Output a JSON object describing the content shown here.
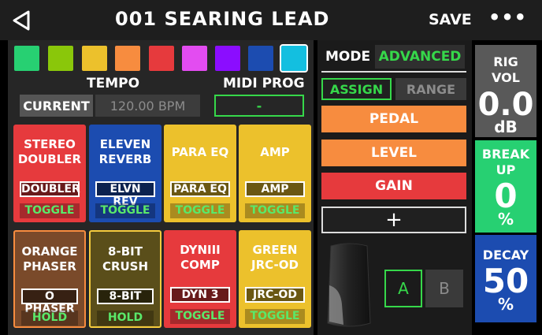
{
  "header": {
    "title": "001 SEARING LEAD",
    "save_label": "SAVE",
    "more_label": "•••"
  },
  "colors": [
    "#27d072",
    "#8ac70a",
    "#ecc12c",
    "#f78c3f",
    "#e63a3d",
    "#e34cf1",
    "#8b0dff",
    "#1c4cb0",
    "#13bfe0"
  ],
  "tempo": {
    "label": "TEMPO",
    "mode": "CURRENT",
    "value": "120.00 BPM"
  },
  "midi": {
    "label": "MIDI PROG",
    "value": "-"
  },
  "footswitches": [
    {
      "name1": "STEREO",
      "name2": "DOUBLER",
      "label": "DOUBLER",
      "action": "TOGGLE",
      "color": "#e63a3d"
    },
    {
      "name1": "ELEVEN",
      "name2": "REVERB",
      "label": "ELVN REV",
      "action": "TOGGLE",
      "color": "#1c4cb0"
    },
    {
      "name1": "PARA EQ",
      "name2": "",
      "label": "PARA EQ",
      "action": "TOGGLE",
      "color": "#ecc12c"
    },
    {
      "name1": "AMP",
      "name2": "",
      "label": "AMP",
      "action": "TOGGLE",
      "color": "#ecc12c"
    },
    {
      "name1": "ORANGE",
      "name2": "PHASER",
      "label": "O PHASER",
      "action": "HOLD",
      "color": "#7a4a2a"
    },
    {
      "name1": "8-BIT",
      "name2": "CRUSH",
      "label": "8-BIT",
      "action": "HOLD",
      "color": "#5a4e1a"
    },
    {
      "name1": "DYNIII",
      "name2": "COMP",
      "label": "DYN 3",
      "action": "TOGGLE",
      "color": "#e63a3d"
    },
    {
      "name1": "GREEN",
      "name2": "JRC-OD",
      "label": "JRC-OD",
      "action": "TOGGLE",
      "color": "#ecc12c"
    }
  ],
  "mode": {
    "label": "MODE",
    "value": "ADVANCED"
  },
  "tabs": {
    "assign": "ASSIGN",
    "range": "RANGE"
  },
  "assignments": [
    {
      "label": "PEDAL",
      "color": "#f78c3f"
    },
    {
      "label": "LEVEL",
      "color": "#f78c3f"
    },
    {
      "label": "GAIN",
      "color": "#e63a3d"
    }
  ],
  "add_label": "+",
  "ab": {
    "a": "A",
    "b": "B"
  },
  "right": {
    "rigvol": {
      "title1": "RIG",
      "title2": "VOL",
      "value": "0.0",
      "unit": "dB",
      "color": "#595959"
    },
    "breakup": {
      "title1": "BREAK",
      "title2": "UP",
      "value": "0",
      "unit": "%",
      "color": "#27d072"
    },
    "decay": {
      "title1": "DECAY",
      "title2": "",
      "value": "50",
      "unit": "%",
      "color": "#1c4cb0"
    }
  }
}
